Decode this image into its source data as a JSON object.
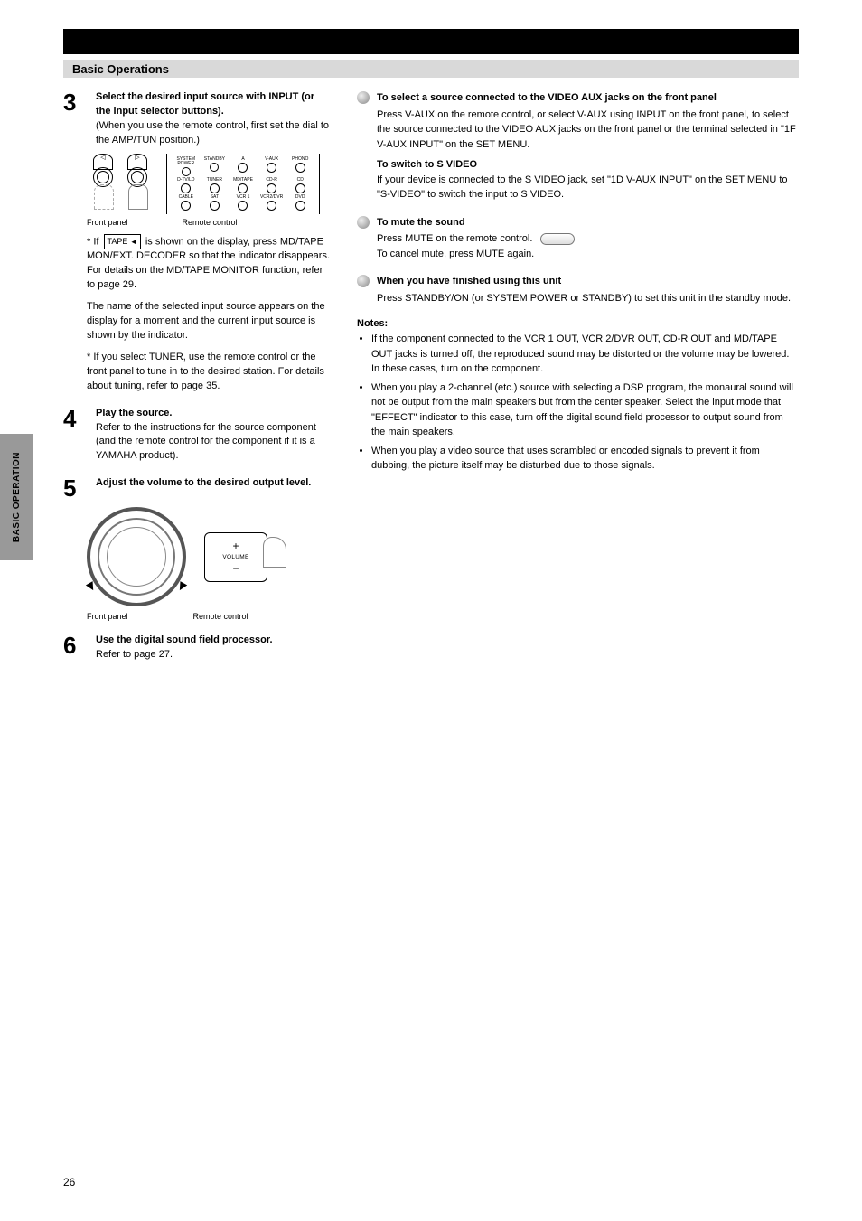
{
  "side_tab": "BASIC OPERATION",
  "black_bar_title": "",
  "gray_bar_title": "Basic Operations",
  "left": {
    "step3": {
      "num": "3",
      "title": "Select the desired input source with INPUT (or the input selector buttons).",
      "p1": "(When you use the remote control, first set the dial to the AMP/TUN position.)",
      "p2": "The name of the selected input source appears on the display for a moment and the current input source is shown by the indicator.",
      "p3": "* If you select TUNER, use the remote control or the front panel to tune in to the desired station. For details about tuning, refer to page 35.",
      "label_front": "Front panel",
      "label_remote": "Remote control"
    },
    "remote_buttons": {
      "r1c1": "SYSTEM POWER",
      "r1c2": "STANDBY",
      "r1c3": "A",
      "r1c4": "V-AUX",
      "r1c5": "PHONO",
      "r2c1": "D-TV/LD",
      "r2c2": "TUNER",
      "r2c3": "MD/TAPE",
      "r2c4": "CD-R",
      "r2c5": "CD",
      "r3c1": "CABLE",
      "r3c2": "SAT",
      "r3c3": "VCR 1",
      "r3c4": "VCR2/DVR",
      "r3c5": "DVD"
    },
    "tape_note": {
      "line1": "* If",
      "tape_label": "TAPE",
      "line2": "is shown on the display, press",
      "line3": "MD/TAPE MON/EXT. DECODER so that the indicator disappears. For details on the MD/TAPE MONITOR function, refer to page 29."
    },
    "step4": {
      "num": "4",
      "title": "Play the source.",
      "body": "Refer to the instructions for the source component (and the remote control for the component if it is a YAMAHA product)."
    },
    "step5": {
      "num": "5",
      "title": "Adjust the volume to the desired output level.",
      "label_front": "Front panel",
      "label_remote": "Remote control",
      "remote_vol": "VOLUME"
    },
    "step6": {
      "num": "6",
      "title": "Use the digital sound field processor.",
      "body": "Refer to page 27."
    }
  },
  "right": {
    "block1": {
      "title": "To select a source connected to the VIDEO AUX jacks on the front panel",
      "body": "Press V-AUX on the remote control, or select V-AUX using INPUT on the front panel, to select the source connected to the VIDEO AUX jacks on the front panel or the terminal selected in \"1F V-AUX INPUT\" on the SET MENU.",
      "sub_bold": "To switch to S VIDEO",
      "sub_body": "If your device is connected to the S VIDEO jack, set \"1D V-AUX INPUT\" on the SET MENU to \"S-VIDEO\" to switch the input to S VIDEO."
    },
    "block_mute": {
      "title": "To mute the sound",
      "body": "Press MUTE on the remote control.",
      "body2": "To cancel mute, press MUTE again."
    },
    "block_finish": {
      "title": "When you have finished using this unit",
      "body": "Press STANDBY/ON (or SYSTEM POWER or STANDBY) to set this unit in the standby mode."
    },
    "notes_header": "Notes:",
    "notes": [
      "If the component connected to the VCR 1 OUT, VCR 2/DVR OUT, CD-R OUT and MD/TAPE OUT jacks is turned off, the reproduced sound may be distorted or the volume may be lowered. In these cases, turn on the component.",
      "When you play a 2-channel (etc.) source with selecting a DSP program, the monaural sound will not be output from the main speakers but from the center speaker. Select the input mode that \"EFFECT\" indicator to this case, turn off the digital sound field processor to output sound from the main speakers.",
      "When you play a video source that uses scrambled or encoded signals to prevent it from dubbing, the picture itself may be disturbed due to those signals."
    ]
  },
  "page_number": "26"
}
